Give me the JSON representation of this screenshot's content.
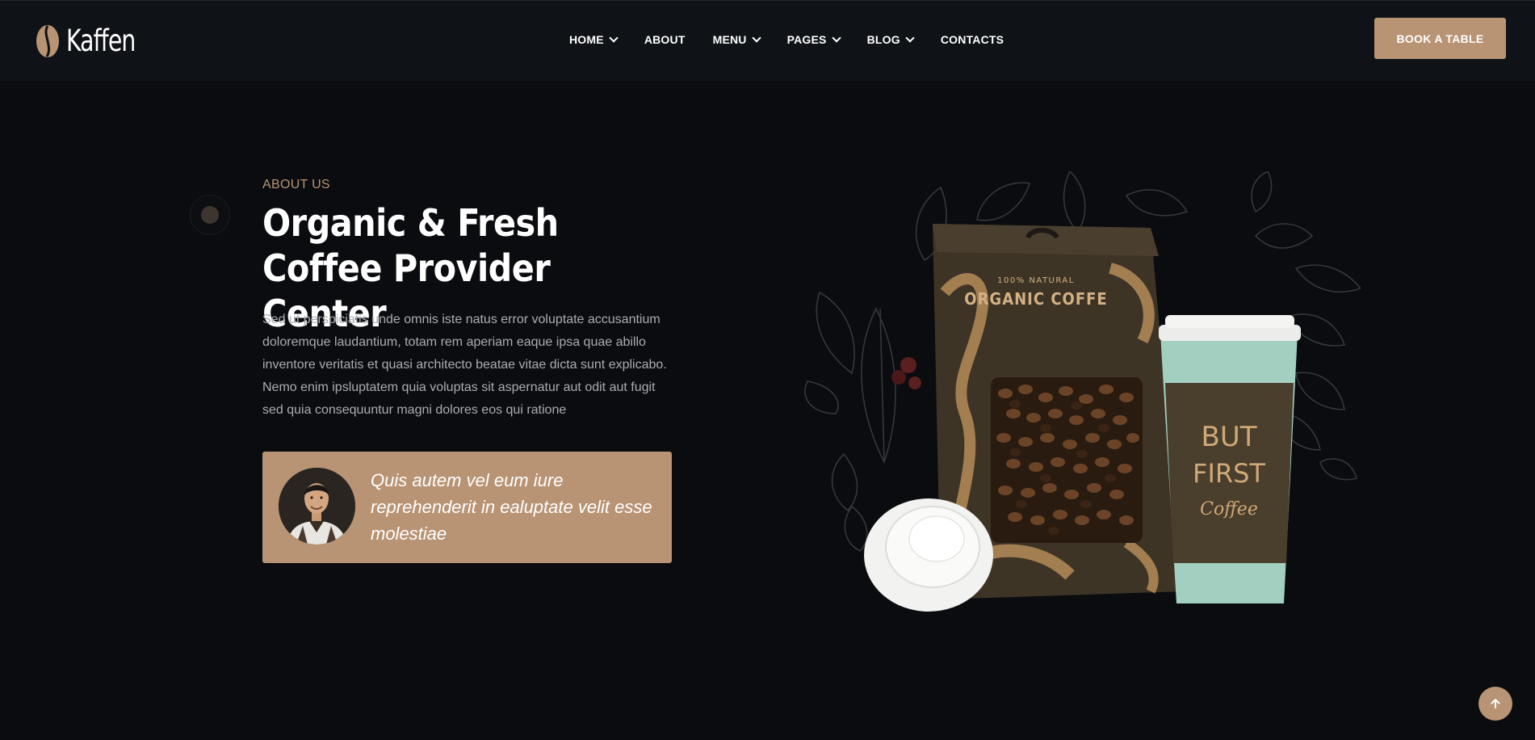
{
  "brand": {
    "name": "Kaffen"
  },
  "nav": {
    "items": [
      {
        "label": "HOME",
        "has_dropdown": true
      },
      {
        "label": "ABOUT",
        "has_dropdown": false
      },
      {
        "label": "MENU",
        "has_dropdown": true
      },
      {
        "label": "PAGES",
        "has_dropdown": true
      },
      {
        "label": "BLOG",
        "has_dropdown": true
      },
      {
        "label": "CONTACTS",
        "has_dropdown": false
      }
    ],
    "cta_label": "BOOK A TABLE"
  },
  "about": {
    "tag": "ABOUT US",
    "title": "Organic & Fresh Coffee Provider Center",
    "description": "Sed ut perspiciatis unde omnis iste natus error voluptate accusantium doloremque laudantium, totam rem aperiam eaque ipsa quae abillo inventore veritatis et quasi architecto beatae vitae dicta sunt explicabo. Nemo enim ipsluptatem quia voluptas sit aspernatur aut odit aut fugit sed quia consequuntur magni dolores eos qui ratione",
    "quote": "Quis autem vel eum iure reprehenderit in ealuptate velit esse molestiae"
  },
  "product": {
    "bag_small_text": "100% NATURAL",
    "bag_label": "ORGANIC COFFE",
    "cup_text_1": "BUT",
    "cup_text_2": "FIRST",
    "cup_text_3": "Coffee"
  },
  "colors": {
    "accent": "#b89474",
    "background": "#0a0c0f",
    "header_bg": "#0f1318"
  },
  "icons": {
    "logo": "coffee-bean-icon",
    "dropdown": "chevron-down-icon",
    "scroll_top": "arrow-up-icon"
  }
}
